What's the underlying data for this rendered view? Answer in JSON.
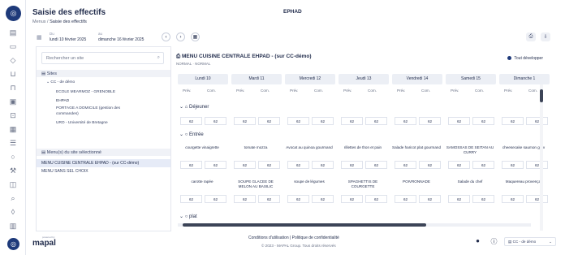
{
  "header": {
    "title": "Saisie des effectifs",
    "breadcrumb": [
      "Menus",
      "/",
      "Saisie des effectifs"
    ],
    "center_label": "EPHAD"
  },
  "dates": {
    "from_label": "Du",
    "from_value": "lundi 10 février 2025",
    "to_label": "au",
    "to_value": "dimanche 16 février 2025"
  },
  "left_panel": {
    "search_placeholder": "Rechercher un site",
    "sites_label": "Sites",
    "tree": [
      "CC - de démo",
      "ECOLE MEARMOZ - GRENOBLE",
      "EHPAD",
      "PORTAGE A DOMICILE (gestion des",
      "commandes)",
      "URO - Université de Bretagne"
    ],
    "menus_label": "Menu(s) du site sélectionné",
    "menus": [
      "MENU CUISINE CENTRALE EHPAD - (sur CC-démo)",
      "MENU SANS SEL CHOIX"
    ]
  },
  "main": {
    "title": "MENU CUISINE CENTRALE EHPAD - (sur CC-démo)",
    "subtitle": "NORMAL · NORMAL",
    "expand_all": "Tout développer",
    "days": [
      "Lundi 10",
      "Mardi 11",
      "Mercredi 12",
      "Jeudi 13",
      "Vendredi 14",
      "Samedi 15",
      "Dimanche 1"
    ],
    "prev_label": "Prév.",
    "com_label": "Com.",
    "group_lunch": "Déjeuner",
    "group_entree": "Entrée",
    "group_plat": "plat",
    "value": "62",
    "dishes_row1": [
      "courgette vinaigrette",
      "tomate mozza",
      "Avocat au quinoa gourmand",
      "rillettes de thon et pain",
      "Salade haricot plat gourmand",
      "SAMOSSAS DE SEITAN AU CURRY",
      "cheesecake saumon grav"
    ],
    "dishes_row2": [
      "carotte rapée",
      "SOUPE GLACEE DE MELON AU BASILIC",
      "soupe de légumes",
      "SPAGHETTIS DE COURGETTE",
      "POIVRONNADE",
      "Salade du chef",
      "Maquereau provençal"
    ]
  },
  "footer": {
    "brand": "mapal",
    "powered_by": "powered by",
    "links": "Conditions d'utilisation  |  Politique de confidentialité",
    "copyright": "© 2023 - MAPAL Group. Tous droits réservés",
    "site_select": "CC - de démo"
  }
}
